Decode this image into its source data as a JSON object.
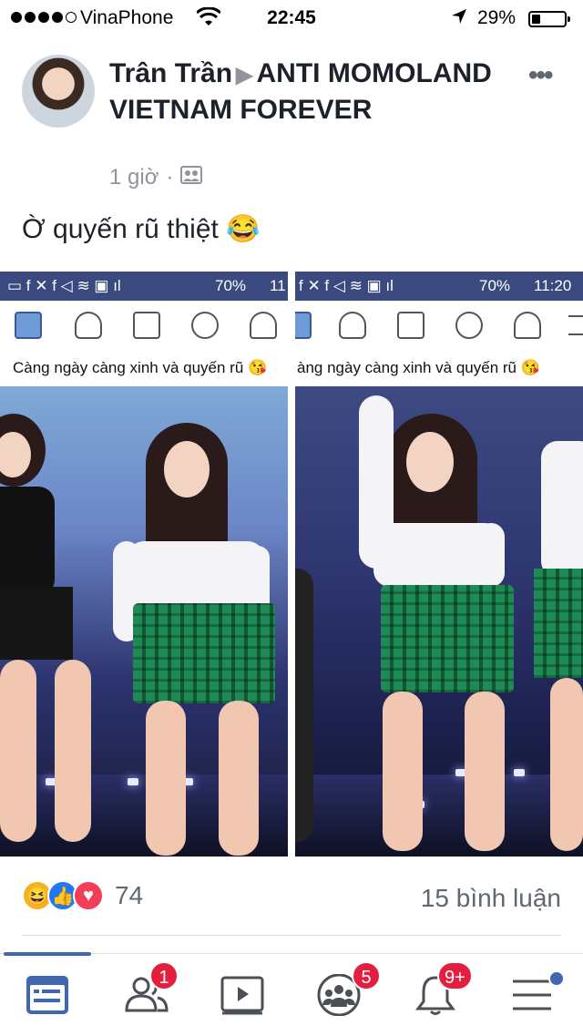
{
  "status_bar": {
    "carrier": "VinaPhone",
    "time": "22:45",
    "battery": "29%",
    "icons": [
      "signal-dots",
      "wifi-icon",
      "location-arrow-icon",
      "battery-icon"
    ]
  },
  "post": {
    "author": "Trân Trần",
    "group": "ANTI MOMOLAND VIETNAM FOREVER",
    "time": "1 giờ",
    "privacy_icon": "group-icon",
    "caption": "Ờ quyến rũ thiệt 😂"
  },
  "photos": [
    {
      "status": {
        "battery": "70%",
        "time": "11"
      },
      "caption": "Càng ngày càng xinh và quyến rũ 😘"
    },
    {
      "status": {
        "battery": "70%",
        "time": "11:20"
      },
      "caption": "àng ngày càng xinh và quyến rũ 😘"
    }
  ],
  "engagement": {
    "reaction_count": "74",
    "reactions": [
      "haha",
      "like",
      "love"
    ],
    "comments": "15 bình luận"
  },
  "tabbar": {
    "items": [
      {
        "name": "news-feed",
        "badge": ""
      },
      {
        "name": "friend-requests",
        "badge": "1"
      },
      {
        "name": "watch",
        "badge": ""
      },
      {
        "name": "groups",
        "badge": "5"
      },
      {
        "name": "notifications",
        "badge": "9+"
      },
      {
        "name": "menu",
        "badge": ""
      }
    ]
  },
  "colors": {
    "accent": "#4267b2",
    "badge": "#e41e3f",
    "secondary_text": "#90949c"
  }
}
